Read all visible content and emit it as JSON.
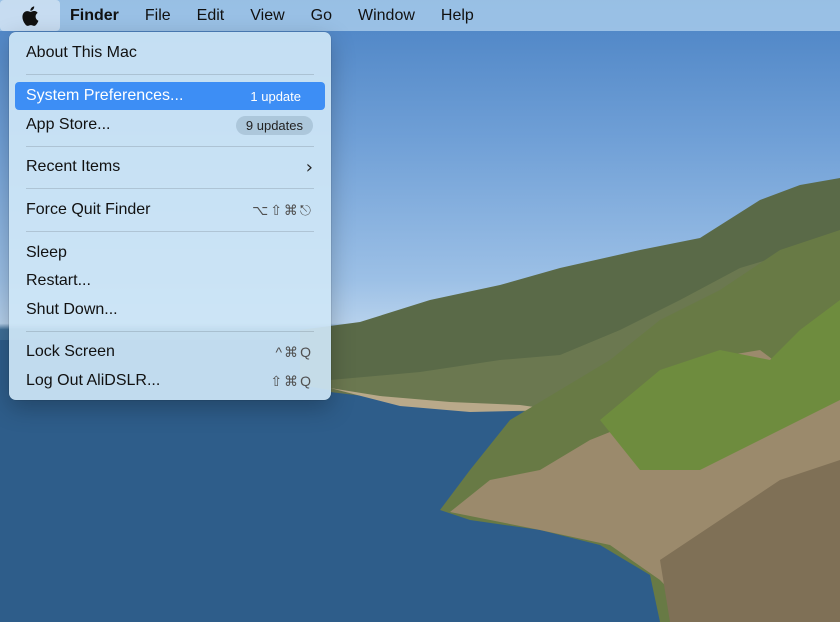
{
  "menubar": {
    "apple_icon": "apple-logo-icon",
    "items": [
      "Finder",
      "File",
      "Edit",
      "View",
      "Go",
      "Window",
      "Help"
    ]
  },
  "apple_menu": {
    "about": "About This Mac",
    "system_prefs": {
      "label": "System Preferences...",
      "badge": "1 update"
    },
    "app_store": {
      "label": "App Store...",
      "badge": "9 updates"
    },
    "recent_items": {
      "label": "Recent Items",
      "icon": "chevron-right-icon"
    },
    "force_quit": {
      "label": "Force Quit Finder",
      "shortcut": "⌥⇧⌘⎋"
    },
    "sleep": "Sleep",
    "restart": "Restart...",
    "shut_down": "Shut Down...",
    "lock_screen": {
      "label": "Lock Screen",
      "shortcut": "^⌘Q"
    },
    "log_out": {
      "label": "Log Out AliDSLR...",
      "shortcut": "⇧⌘Q"
    }
  },
  "colors": {
    "selection": "#3d8ef5",
    "menubar_bg": "#aacdec",
    "menu_bg": "#cee6f6"
  }
}
